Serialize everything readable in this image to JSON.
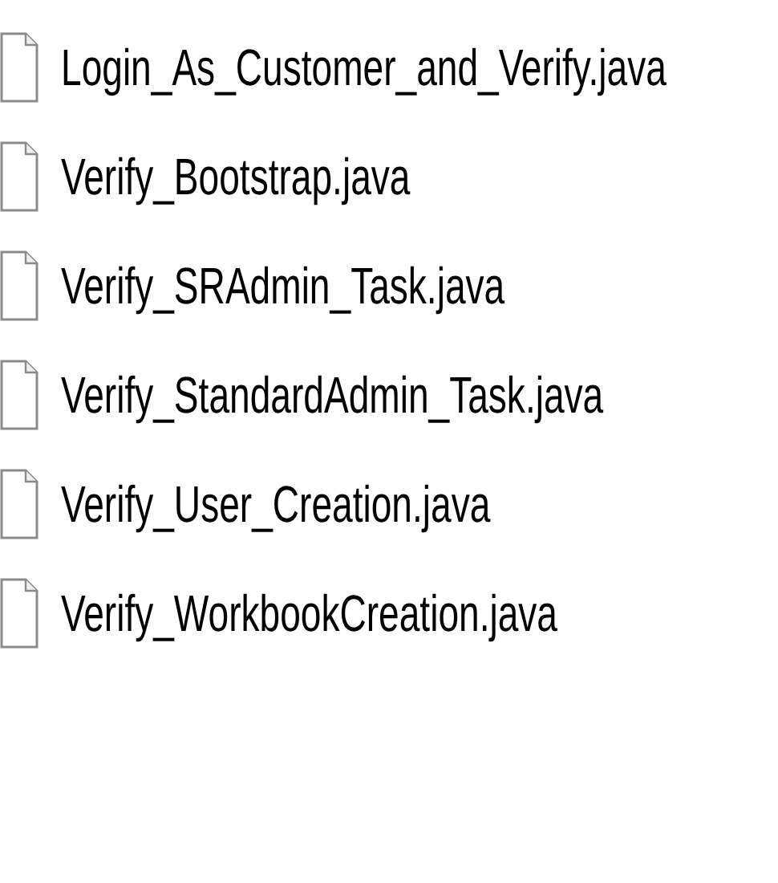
{
  "files": [
    {
      "name": "Login_As_Customer_and_Verify.java"
    },
    {
      "name": "Verify_Bootstrap.java"
    },
    {
      "name": "Verify_SRAdmin_Task.java"
    },
    {
      "name": "Verify_StandardAdmin_Task.java"
    },
    {
      "name": "Verify_User_Creation.java"
    },
    {
      "name": "Verify_WorkbookCreation.java"
    }
  ]
}
